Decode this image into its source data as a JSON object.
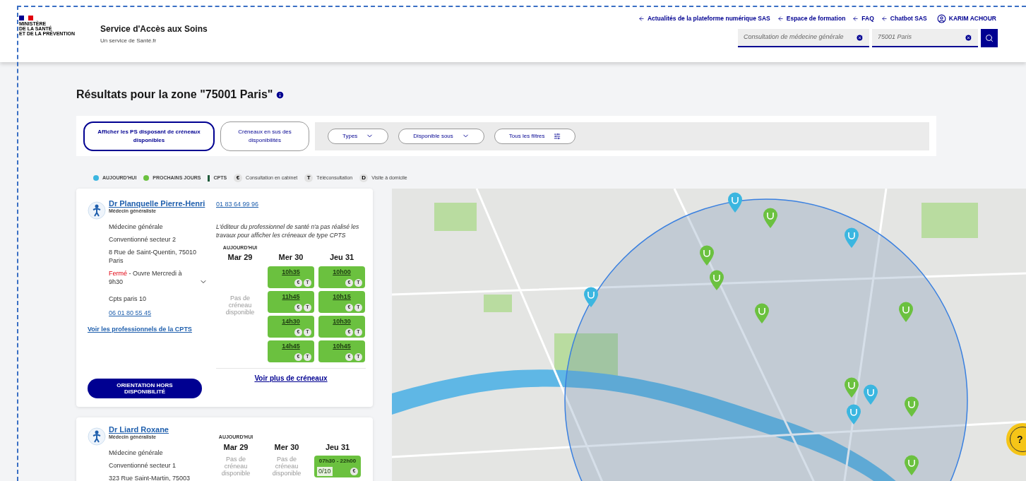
{
  "header": {
    "ministry": [
      "MINISTÈRE",
      "DE LA SANTÉ",
      "ET DE LA PRÉVENTION"
    ],
    "title": "Service d'Accès aux Soins",
    "subtitle": "Un service de Santé.fr",
    "links": [
      "Actualités de la plateforme numérique SAS",
      "Espace de formation",
      "FAQ",
      "Chatbot SAS"
    ],
    "user": "KARIM ACHOUR",
    "search": {
      "what": "Consultation de médecine générale",
      "where": "75001 Paris"
    }
  },
  "results": {
    "title": "Résultats pour la zone \"75001 Paris\"",
    "toggles": [
      {
        "label": "Afficher les PS disposant de créneaux disponibles",
        "selected": true
      },
      {
        "label": "Créneaux en sus des disponibilités",
        "selected": false
      }
    ],
    "filters": [
      {
        "label": "Types",
        "kind": "dropdown"
      },
      {
        "label": "Disponible sous",
        "kind": "dropdown"
      },
      {
        "label": "Tous les filtres",
        "kind": "settings"
      }
    ],
    "legend": [
      {
        "kind": "dot",
        "label": "AUJOURD'HUI",
        "color": "#3bb6e0"
      },
      {
        "kind": "dot",
        "label": "PROCHAINS JOURS",
        "color": "#6bc13f"
      },
      {
        "kind": "bar",
        "label": "CPTS",
        "color": "#1f5a3a"
      },
      {
        "kind": "badge",
        "badge": "€",
        "label": "Consultation en cabinet"
      },
      {
        "kind": "badge",
        "badge": "T",
        "label": "Téléconsultation"
      },
      {
        "kind": "badge",
        "badge": "D",
        "label": "Visite à domicile"
      }
    ]
  },
  "cards": [
    {
      "name": "Dr Planquelle Pierre-Henri",
      "specialty": "Médecin généraliste",
      "details": [
        "Médecine générale",
        "Conventionné secteur 2",
        "8 Rue de Saint-Quentin, 75010 Paris"
      ],
      "status": {
        "closed": "Fermé",
        "text": " - Ouvre Mercredi à 9h30",
        "expanded": false
      },
      "cpts": {
        "name": "Cpts paris 10",
        "phone": "06 01 80 55 45",
        "link": "Voir les professionnels de la CPTS"
      },
      "button": "ORIENTATION HORS DISPONIBILITÉ",
      "phone": "01 83 64 99 96",
      "notice": "L'éditeur du professionnel de santé n'a pas réalisé les travaux pour afficher les créneaux de type CPTS",
      "days": [
        {
          "today": "AUJOURD'HUI",
          "label": "Mar 29",
          "empty": "Pas de créneau disponible"
        },
        {
          "label": "Mer 30",
          "slots": [
            {
              "kind": "slot",
              "time": "10h35",
              "modes": [
                "€",
                "T"
              ]
            },
            {
              "kind": "slot",
              "time": "11h45",
              "modes": [
                "€",
                "T"
              ]
            },
            {
              "kind": "slot",
              "time": "14h30",
              "modes": [
                "€",
                "T"
              ]
            },
            {
              "kind": "slot",
              "time": "14h45",
              "modes": [
                "€",
                "T"
              ]
            }
          ]
        },
        {
          "label": "Jeu 31",
          "slots": [
            {
              "kind": "slot",
              "time": "10h00",
              "modes": [
                "€",
                "T"
              ]
            },
            {
              "kind": "slot",
              "time": "10h15",
              "modes": [
                "€",
                "T"
              ]
            },
            {
              "kind": "slot",
              "time": "10h30",
              "modes": [
                "€",
                "T"
              ]
            },
            {
              "kind": "slot",
              "time": "10h45",
              "modes": [
                "€",
                "T"
              ]
            }
          ]
        }
      ],
      "more": "Voir plus de créneaux"
    },
    {
      "name": "Dr Liard Roxane",
      "specialty": "Médecin généraliste",
      "details": [
        "Médecine générale",
        "Conventionné secteur 1",
        "323 Rue Saint-Martin, 75003"
      ],
      "days": [
        {
          "today": "AUJOURD'HUI",
          "label": "Mar 29",
          "empty": "Pas de créneau disponible"
        },
        {
          "label": "Mer 30",
          "empty": "Pas de créneau disponible"
        },
        {
          "label": "Jeu 31",
          "slots": [
            {
              "kind": "range",
              "time": "07h30 - 22h00",
              "count": "0/10",
              "modes": [
                "€"
              ]
            }
          ]
        }
      ]
    }
  ],
  "map": {
    "pins": [
      {
        "color": "#3bb6e0"
      },
      {
        "color": "#6bc13f"
      },
      {
        "color": "#3bb6e0"
      },
      {
        "color": "#6bc13f"
      },
      {
        "color": "#6bc13f"
      },
      {
        "color": "#3bb6e0"
      },
      {
        "color": "#6bc13f"
      },
      {
        "color": "#6bc13f"
      },
      {
        "color": "#6bc13f"
      },
      {
        "color": "#3bb6e0"
      },
      {
        "color": "#3bb6e0"
      },
      {
        "color": "#6bc13f"
      },
      {
        "color": "#6bc13f"
      }
    ]
  },
  "help": "?"
}
